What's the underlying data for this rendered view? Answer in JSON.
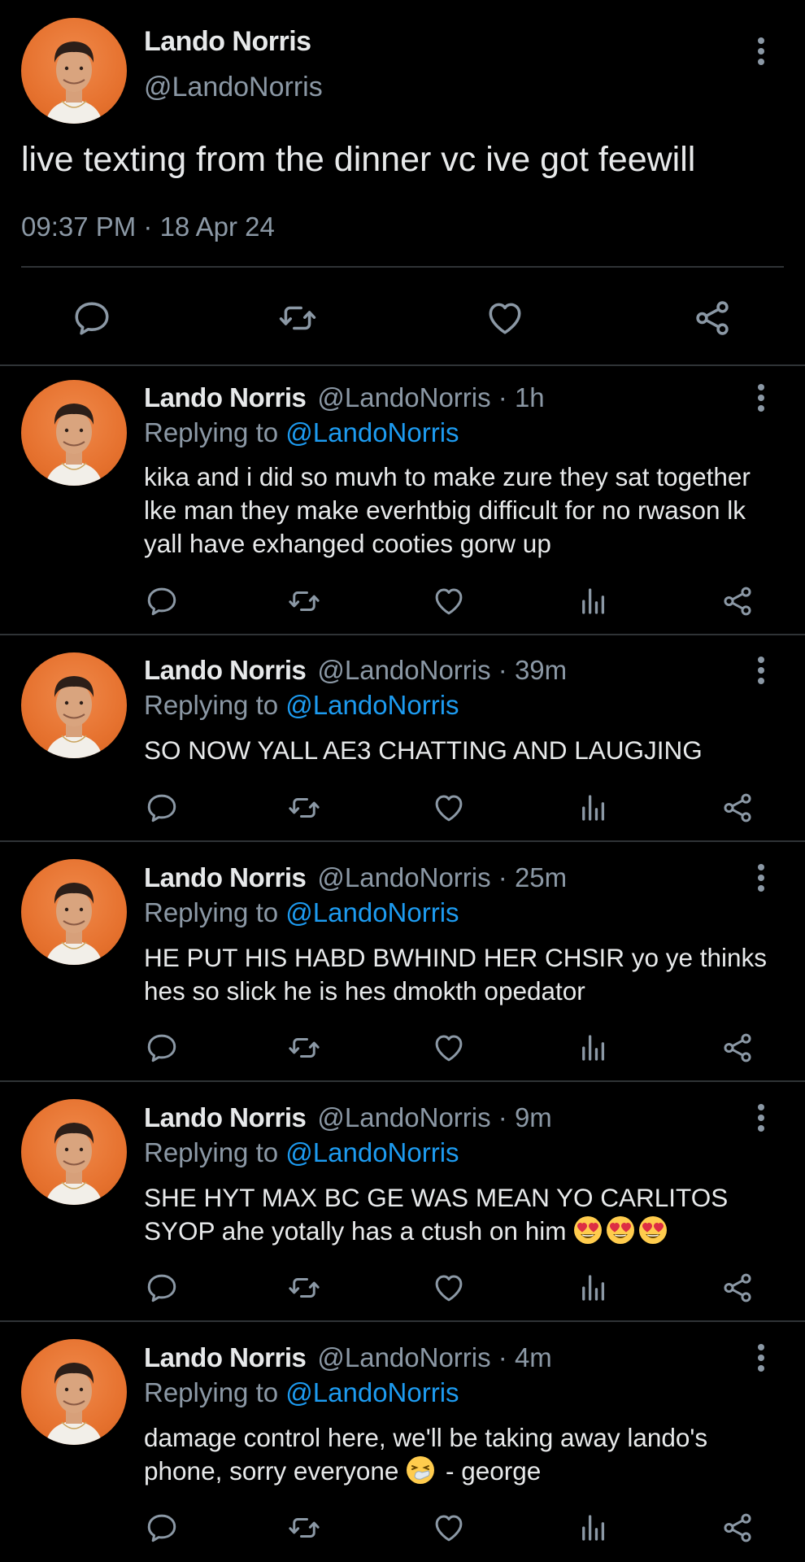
{
  "main_tweet": {
    "name": "Lando Norris",
    "handle": "@LandoNorris",
    "text": "live texting from the dinner vc ive got feewill",
    "timestamp": "09:37 PM · 18 Apr 24"
  },
  "replies": [
    {
      "name": "Lando Norris",
      "handle_time": "@LandoNorris · 1h",
      "replying_prefix": "Replying to",
      "replying_to": "@LandoNorris",
      "text": "kika and i did so muvh to make zure they sat together lke man they make everhtbig difficult for no rwason lk yall have exhanged cooties gorw up"
    },
    {
      "name": "Lando Norris",
      "handle_time": "@LandoNorris · 39m",
      "replying_prefix": "Replying to",
      "replying_to": "@LandoNorris",
      "text": "SO NOW YALL AE3 CHATTING AND LAUGJING"
    },
    {
      "name": "Lando Norris",
      "handle_time": "@LandoNorris · 25m",
      "replying_prefix": "Replying to",
      "replying_to": "@LandoNorris",
      "text": "HE PUT HIS HABD BWHIND HER CHSIR yo ye thinks hes so slick he is hes dmokth opedator"
    },
    {
      "name": "Lando Norris",
      "handle_time": "@LandoNorris · 9m",
      "replying_prefix": "Replying to",
      "replying_to": "@LandoNorris",
      "text": "SHE HYT MAX BC GE WAS MEAN YO CARLITOS SYOP ahe yotally has a ctush on him",
      "emoji": [
        "heart-eyes-emoji",
        "heart-eyes-emoji",
        "heart-eyes-emoji"
      ]
    },
    {
      "name": "Lando Norris",
      "handle_time": "@LandoNorris · 4m",
      "replying_prefix": "Replying to",
      "replying_to": "@LandoNorris",
      "text_before": "damage control here, we'll be taking away lando's phone, sorry everyone",
      "text_after": " - george",
      "emoji": [
        "sneezing-face-emoji"
      ]
    }
  ],
  "icons": {
    "reply": "reply-icon",
    "retweet": "retweet-icon",
    "like": "like-icon",
    "views": "views-icon",
    "share": "share-icon",
    "more": "more-icon"
  },
  "colors": {
    "background": "#000000",
    "text": "#e7e9ea",
    "muted": "#8b98a5",
    "link": "#1d9bf0",
    "divider": "#2f3336",
    "avatar": "#e6722f"
  }
}
